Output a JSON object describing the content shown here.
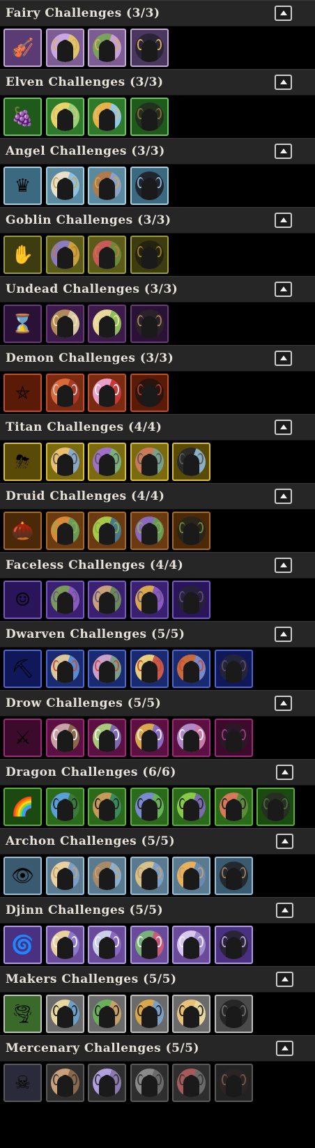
{
  "sections": [
    {
      "key": "fairy",
      "title": "Fairy Challenges (3/3)",
      "theme": "#8a6b9a",
      "border": "#c5a9d6",
      "tiles": [
        {
          "type": "item",
          "icon": "violin-icon",
          "glyph": "🎻",
          "bg": "#5a3b73"
        },
        {
          "type": "medal",
          "icon": "fairy-medal-icon",
          "colors": [
            "#c9a7e0",
            "#e0c36a"
          ],
          "wing": "#d8b25a",
          "bg": "#7d5c93"
        },
        {
          "type": "medal",
          "icon": "fairy-medal-icon",
          "colors": [
            "#7aa25a",
            "#c7a0d8"
          ],
          "wing": "#d8b25a",
          "bg": "#7d5c93"
        },
        {
          "type": "medal",
          "icon": "fairy-medal-icon",
          "colors": [
            "#2a2436",
            "#2a2436"
          ],
          "wing": "#d8b25a",
          "bg": "#4a3760"
        }
      ]
    },
    {
      "key": "elven",
      "title": "Elven Challenges (3/3)",
      "theme": "#2f7a2a",
      "border": "#6cc45f",
      "tiles": [
        {
          "type": "item",
          "icon": "grapes-icon",
          "glyph": "🍇",
          "bg": "#1f5a1c"
        },
        {
          "type": "medal",
          "icon": "elf-medal-icon",
          "colors": [
            "#e8d26a",
            "#9bd07a"
          ],
          "wing": "#d8c07a",
          "bg": "#2f7a2a"
        },
        {
          "type": "medal",
          "icon": "elf-medal-icon",
          "colors": [
            "#e8b24a",
            "#8fc8e8"
          ],
          "wing": "#d8c07a",
          "bg": "#2f7a2a"
        },
        {
          "type": "medal",
          "icon": "elf-medal-icon",
          "colors": [
            "#22301f",
            "#22301f"
          ],
          "wing": "#8a6b3a",
          "bg": "#1f5a1c"
        }
      ]
    },
    {
      "key": "angel",
      "title": "Angel Challenges (3/3)",
      "theme": "#5a8aa0",
      "border": "#a8cfe0",
      "tiles": [
        {
          "type": "item",
          "icon": "throne-icon",
          "glyph": "♛",
          "bg": "#3b6a80"
        },
        {
          "type": "medal",
          "icon": "angel-medal-icon",
          "colors": [
            "#e8e0c8",
            "#8fc0e0"
          ],
          "wing": "#c7a75a",
          "bg": "#5a8aa0"
        },
        {
          "type": "medal",
          "icon": "angel-medal-icon",
          "colors": [
            "#b07a4a",
            "#8fa0c8"
          ],
          "wing": "#c7a75a",
          "bg": "#5a8aa0"
        },
        {
          "type": "medal",
          "icon": "angel-medal-icon",
          "colors": [
            "#20262e",
            "#20262e"
          ],
          "wing": "#8fb0d0",
          "bg": "#3b6a80"
        }
      ]
    },
    {
      "key": "goblin",
      "title": "Goblin Challenges (3/3)",
      "theme": "#5a5a1a",
      "border": "#9b9b3a",
      "tiles": [
        {
          "type": "item",
          "icon": "goblin-hand-icon",
          "glyph": "✋",
          "bg": "#3c3c10"
        },
        {
          "type": "medal",
          "icon": "goblin-medal-icon",
          "colors": [
            "#8a7ac0",
            "#c8a23a"
          ],
          "wing": "#c07a3a",
          "bg": "#5a5a1a"
        },
        {
          "type": "medal",
          "icon": "goblin-medal-icon",
          "colors": [
            "#c85a5a",
            "#6a8a3a"
          ],
          "wing": "#c07a3a",
          "bg": "#5a5a1a"
        },
        {
          "type": "medal",
          "icon": "goblin-medal-icon",
          "colors": [
            "#24230f",
            "#24230f"
          ],
          "wing": "#9b7a2a",
          "bg": "#3c3c10"
        }
      ]
    },
    {
      "key": "undead",
      "title": "Undead Challenges (3/3)",
      "theme": "#3c1a4a",
      "border": "#6a3a7a",
      "tiles": [
        {
          "type": "item",
          "icon": "hourglass-icon",
          "glyph": "⌛",
          "bg": "#2a1236"
        },
        {
          "type": "medal",
          "icon": "undead-medal-icon",
          "colors": [
            "#b08a5a",
            "#d8c8a8"
          ],
          "wing": "#f0e0a0",
          "bg": "#3c1a4a"
        },
        {
          "type": "medal",
          "icon": "undead-medal-icon",
          "colors": [
            "#e8d89a",
            "#8fbf5a"
          ],
          "wing": "#f0e0a0",
          "bg": "#3c1a4a"
        },
        {
          "type": "medal",
          "icon": "undead-medal-icon",
          "colors": [
            "#2a2228",
            "#2a2228"
          ],
          "wing": "#a08060",
          "bg": "#2a1236"
        }
      ]
    },
    {
      "key": "demon",
      "title": "Demon Challenges (3/3)",
      "theme": "#7a2a10",
      "border": "#c0502a",
      "tiles": [
        {
          "type": "item",
          "icon": "pentagram-icon",
          "glyph": "⛤",
          "bg": "#5a1a08"
        },
        {
          "type": "medal",
          "icon": "demon-medal-icon",
          "colors": [
            "#d86a3a",
            "#a83a2a"
          ],
          "wing": "#c8c8c8",
          "bg": "#7a2a10"
        },
        {
          "type": "medal",
          "icon": "demon-medal-icon",
          "colors": [
            "#e8a0c8",
            "#c83a3a"
          ],
          "wing": "#f0f0f0",
          "bg": "#7a2a10"
        },
        {
          "type": "medal",
          "icon": "demon-medal-icon",
          "colors": [
            "#2a1410",
            "#2a1410"
          ],
          "wing": "#a04030",
          "bg": "#5a1a08"
        }
      ]
    },
    {
      "key": "titan",
      "title": "Titan Challenges (4/4)",
      "theme": "#7a6a10",
      "border": "#d8c030",
      "tiles": [
        {
          "type": "item",
          "icon": "storm-cloud-icon",
          "glyph": "⛈",
          "bg": "#5a4a08"
        },
        {
          "type": "medal",
          "icon": "titan-medal-icon",
          "colors": [
            "#e8c070",
            "#8aa8c8"
          ],
          "wing": "#5a5a5a",
          "bg": "#7a6a10"
        },
        {
          "type": "medal",
          "icon": "titan-medal-icon",
          "colors": [
            "#a070c8",
            "#7ab07a"
          ],
          "wing": "#5a5a5a",
          "bg": "#7a6a10"
        },
        {
          "type": "medal",
          "icon": "titan-medal-icon",
          "colors": [
            "#c87a5a",
            "#7aa08a"
          ],
          "wing": "#5a5a5a",
          "bg": "#7a6a10"
        },
        {
          "type": "medal",
          "icon": "titan-medal-icon",
          "colors": [
            "#2a2a2a",
            "#8ab0c8"
          ],
          "wing": "#5a5a5a",
          "bg": "#5a4a08"
        }
      ]
    },
    {
      "key": "druid",
      "title": "Druid Challenges (4/4)",
      "theme": "#6a3a10",
      "border": "#a86a2a",
      "tiles": [
        {
          "type": "item",
          "icon": "seed-icon",
          "glyph": "🌰",
          "bg": "#4a2808"
        },
        {
          "type": "medal",
          "icon": "druid-medal-icon",
          "colors": [
            "#d88a3a",
            "#6a9a5a"
          ],
          "wing": "#8ab04a",
          "bg": "#6a3a10"
        },
        {
          "type": "medal",
          "icon": "druid-medal-icon",
          "colors": [
            "#a8c84a",
            "#4a7a8a"
          ],
          "wing": "#8ab04a",
          "bg": "#6a3a10"
        },
        {
          "type": "medal",
          "icon": "druid-medal-icon",
          "colors": [
            "#8a6ac0",
            "#6a9a5a"
          ],
          "wing": "#8ab04a",
          "bg": "#6a3a10"
        },
        {
          "type": "medal",
          "icon": "druid-medal-icon",
          "colors": [
            "#2a241a",
            "#2a241a"
          ],
          "wing": "#6a8a3a",
          "bg": "#4a2808"
        }
      ]
    },
    {
      "key": "faceless",
      "title": "Faceless Challenges (4/4)",
      "theme": "#3a2070",
      "border": "#7a5ac0",
      "tiles": [
        {
          "type": "item",
          "icon": "faceless-head-icon",
          "glyph": "☺",
          "bg": "#2a145a"
        },
        {
          "type": "medal",
          "icon": "faceless-medal-icon",
          "colors": [
            "#7a9a5a",
            "#8a5ac0"
          ],
          "wing": "#6a5a8a",
          "bg": "#3a2070"
        },
        {
          "type": "medal",
          "icon": "faceless-medal-icon",
          "colors": [
            "#c8a07a",
            "#6a8a5a"
          ],
          "wing": "#6a5a8a",
          "bg": "#3a2070"
        },
        {
          "type": "medal",
          "icon": "faceless-medal-icon",
          "colors": [
            "#d8a84a",
            "#8a5ac0"
          ],
          "wing": "#6a5a8a",
          "bg": "#3a2070"
        },
        {
          "type": "medal",
          "icon": "faceless-medal-icon",
          "colors": [
            "#26203a",
            "#26203a"
          ],
          "wing": "#5a4a7a",
          "bg": "#2a145a"
        }
      ]
    },
    {
      "key": "dwarven",
      "title": "Dwarven Challenges (5/5)",
      "theme": "#1a2a70",
      "border": "#4a6ad0",
      "tiles": [
        {
          "type": "item",
          "icon": "pickaxe-icon",
          "glyph": "⛏",
          "bg": "#10185a"
        },
        {
          "type": "medal",
          "icon": "dwarf-medal-icon",
          "colors": [
            "#d8c89a",
            "#5a8ad0"
          ],
          "wing": "#c84a3a",
          "bg": "#1a2a70"
        },
        {
          "type": "medal",
          "icon": "dwarf-medal-icon",
          "colors": [
            "#c8a0c8",
            "#7aa08a"
          ],
          "wing": "#c84a3a",
          "bg": "#1a2a70"
        },
        {
          "type": "medal",
          "icon": "dwarf-medal-icon",
          "colors": [
            "#e8d07a",
            "#c85a4a"
          ],
          "wing": "#c84a3a",
          "bg": "#1a2a70"
        },
        {
          "type": "medal",
          "icon": "dwarf-medal-icon",
          "colors": [
            "#c86a3a",
            "#7a8ac8"
          ],
          "wing": "#c84a3a",
          "bg": "#1a2a70"
        },
        {
          "type": "medal",
          "icon": "dwarf-medal-icon",
          "colors": [
            "#22243a",
            "#22243a"
          ],
          "wing": "#5a4a6a",
          "bg": "#10185a"
        }
      ]
    },
    {
      "key": "drow",
      "title": "Drow Challenges (5/5)",
      "theme": "#5a1040",
      "border": "#a02a7a",
      "tiles": [
        {
          "type": "item",
          "icon": "daggers-icon",
          "glyph": "⚔",
          "bg": "#3c0a2a"
        },
        {
          "type": "medal",
          "icon": "drow-medal-icon",
          "colors": [
            "#c8a0a8",
            "#8a6a4a"
          ],
          "wing": "#f0f0f0",
          "bg": "#5a1040"
        },
        {
          "type": "medal",
          "icon": "drow-medal-icon",
          "colors": [
            "#a8c87a",
            "#7a6ab0"
          ],
          "wing": "#f0f0f0",
          "bg": "#5a1040"
        },
        {
          "type": "medal",
          "icon": "drow-medal-icon",
          "colors": [
            "#d8a84a",
            "#8a6ac0"
          ],
          "wing": "#f0f0f0",
          "bg": "#5a1040"
        },
        {
          "type": "medal",
          "icon": "drow-medal-icon",
          "colors": [
            "#b08ac8",
            "#c87aa8"
          ],
          "wing": "#f0f0f0",
          "bg": "#5a1040"
        },
        {
          "type": "medal",
          "icon": "drow-medal-icon",
          "colors": [
            "#2a1828",
            "#2a1828"
          ],
          "wing": "#a03a7a",
          "bg": "#3c0a2a"
        }
      ]
    },
    {
      "key": "dragon",
      "title": "Dragon Challenges (6/6)",
      "theme": "#2a6a1a",
      "border": "#5ab03a",
      "tiles": [
        {
          "type": "item",
          "icon": "dragon-egg-icon",
          "glyph": "🌈",
          "bg": "#1a4a10"
        },
        {
          "type": "medal",
          "icon": "dragon-medal-icon",
          "colors": [
            "#5aa0d8",
            "#3a7a3a"
          ],
          "wing": "#2a2a2a",
          "bg": "#2a6a1a"
        },
        {
          "type": "medal",
          "icon": "dragon-medal-icon",
          "colors": [
            "#c89a5a",
            "#3a8a5a"
          ],
          "wing": "#2a2a2a",
          "bg": "#2a6a1a"
        },
        {
          "type": "medal",
          "icon": "dragon-medal-icon",
          "colors": [
            "#7a8ad0",
            "#6ab05a"
          ],
          "wing": "#2a2a2a",
          "bg": "#2a6a1a"
        },
        {
          "type": "medal",
          "icon": "dragon-medal-icon",
          "colors": [
            "#8ac84a",
            "#7a6ab0"
          ],
          "wing": "#2a2a2a",
          "bg": "#2a6a1a"
        },
        {
          "type": "medal",
          "icon": "dragon-medal-icon",
          "colors": [
            "#d8785a",
            "#5a8a3a"
          ],
          "wing": "#2a2a2a",
          "bg": "#2a6a1a"
        },
        {
          "type": "medal",
          "icon": "dragon-medal-icon",
          "colors": [
            "#262e22",
            "#262e22"
          ],
          "wing": "#4a6a3a",
          "bg": "#1a4a10"
        }
      ]
    },
    {
      "key": "archon",
      "title": "Archon Challenges (5/5)",
      "theme": "#5a7a90",
      "border": "#9ac0d8",
      "tiles": [
        {
          "type": "item",
          "icon": "eye-skull-icon",
          "glyph": "👁",
          "bg": "#3a5a70"
        },
        {
          "type": "medal",
          "icon": "archon-medal-icon",
          "colors": [
            "#e8d0a0",
            "#7aa0c8"
          ],
          "wing": "#c8a06a",
          "bg": "#5a7a90"
        },
        {
          "type": "medal",
          "icon": "archon-medal-icon",
          "colors": [
            "#a88a6a",
            "#8ab0d0"
          ],
          "wing": "#c8a06a",
          "bg": "#5a7a90"
        },
        {
          "type": "medal",
          "icon": "archon-medal-icon",
          "colors": [
            "#d8c08a",
            "#7aa0c8"
          ],
          "wing": "#c8a06a",
          "bg": "#5a7a90"
        },
        {
          "type": "medal",
          "icon": "archon-medal-icon",
          "colors": [
            "#e8b05a",
            "#6a8ab0"
          ],
          "wing": "#c8a06a",
          "bg": "#5a7a90"
        },
        {
          "type": "medal",
          "icon": "archon-medal-icon",
          "colors": [
            "#222a30",
            "#222a30"
          ],
          "wing": "#a07a5a",
          "bg": "#3a5a70"
        }
      ]
    },
    {
      "key": "djinn",
      "title": "Djinn Challenges (5/5)",
      "theme": "#6a4a9a",
      "border": "#b09ae0",
      "tiles": [
        {
          "type": "item",
          "icon": "lamp-swirl-icon",
          "glyph": "🌀",
          "bg": "#4a3080"
        },
        {
          "type": "medal",
          "icon": "djinn-medal-icon",
          "colors": [
            "#e8d0a0",
            "#8a7ac8"
          ],
          "wing": "#f0f0f0",
          "bg": "#6a4a9a"
        },
        {
          "type": "medal",
          "icon": "djinn-medal-icon",
          "colors": [
            "#c8d0e8",
            "#8a6ac0"
          ],
          "wing": "#f0f0f0",
          "bg": "#6a4a9a"
        },
        {
          "type": "medal",
          "icon": "djinn-medal-icon",
          "colors": [
            "#7ab07a",
            "#c85a7a"
          ],
          "wing": "#f0f0f0",
          "bg": "#6a4a9a"
        },
        {
          "type": "medal",
          "icon": "djinn-medal-icon",
          "colors": [
            "#d8c8f0",
            "#a08ad0"
          ],
          "wing": "#f0f0f0",
          "bg": "#6a4a9a"
        },
        {
          "type": "medal",
          "icon": "djinn-medal-icon",
          "colors": [
            "#2a2436",
            "#2a2436"
          ],
          "wing": "#b0a0d0",
          "bg": "#4a3080"
        }
      ]
    },
    {
      "key": "makers",
      "title": "Makers Challenges (5/5)",
      "theme": "#6a6a6a",
      "border": "#c0c0c0",
      "tiles": [
        {
          "type": "item",
          "icon": "vortex-icon",
          "glyph": "🌪",
          "bg": "#3a6a2a"
        },
        {
          "type": "medal",
          "icon": "makers-medal-icon",
          "colors": [
            "#e8d8a0",
            "#6aa0c8"
          ],
          "wing": "#2a2a2a",
          "bg": "#6a6a6a"
        },
        {
          "type": "medal",
          "icon": "makers-medal-icon",
          "colors": [
            "#6ab05a",
            "#c8a06a"
          ],
          "wing": "#2a2a2a",
          "bg": "#6a6a6a"
        },
        {
          "type": "medal",
          "icon": "makers-medal-icon",
          "colors": [
            "#d8a84a",
            "#7aa0c8"
          ],
          "wing": "#2a2a2a",
          "bg": "#6a6a6a"
        },
        {
          "type": "medal",
          "icon": "makers-medal-icon",
          "colors": [
            "#e8c07a",
            "#e8d8a0"
          ],
          "wing": "#2a2a2a",
          "bg": "#6a6a6a"
        },
        {
          "type": "medal",
          "icon": "makers-medal-icon",
          "colors": [
            "#262626",
            "#262626"
          ],
          "wing": "#6a6a6a",
          "bg": "#4a4a4a"
        }
      ]
    },
    {
      "key": "mercenary",
      "title": "Mercenary Challenges (5/5)",
      "theme": "#2e2e2e",
      "border": "#5a5a5a",
      "tiles": [
        {
          "type": "item",
          "icon": "mercenary-mask-icon",
          "glyph": "☠",
          "bg": "#2a2a3a"
        },
        {
          "type": "medal",
          "icon": "mercenary-medal-icon",
          "colors": [
            "#c8a07a",
            "#8a6a4a"
          ],
          "wing": "#3a3a3a",
          "bg": "#2e2e2e"
        },
        {
          "type": "medal",
          "icon": "mercenary-medal-icon",
          "colors": [
            "#b0a0e0",
            "#8a7ab0"
          ],
          "wing": "#3a3a3a",
          "bg": "#2e2e2e"
        },
        {
          "type": "medal",
          "icon": "mercenary-medal-icon",
          "colors": [
            "#8a8a8a",
            "#6a6a6a"
          ],
          "wing": "#3a3a3a",
          "bg": "#2e2e2e"
        },
        {
          "type": "medal",
          "icon": "mercenary-medal-icon",
          "colors": [
            "#a85a5a",
            "#6a6a6a"
          ],
          "wing": "#3a3a3a",
          "bg": "#2e2e2e"
        },
        {
          "type": "medal",
          "icon": "mercenary-medal-icon",
          "colors": [
            "#2a2424",
            "#2a2424"
          ],
          "wing": "#6a5a4a",
          "bg": "#222222"
        }
      ]
    }
  ]
}
